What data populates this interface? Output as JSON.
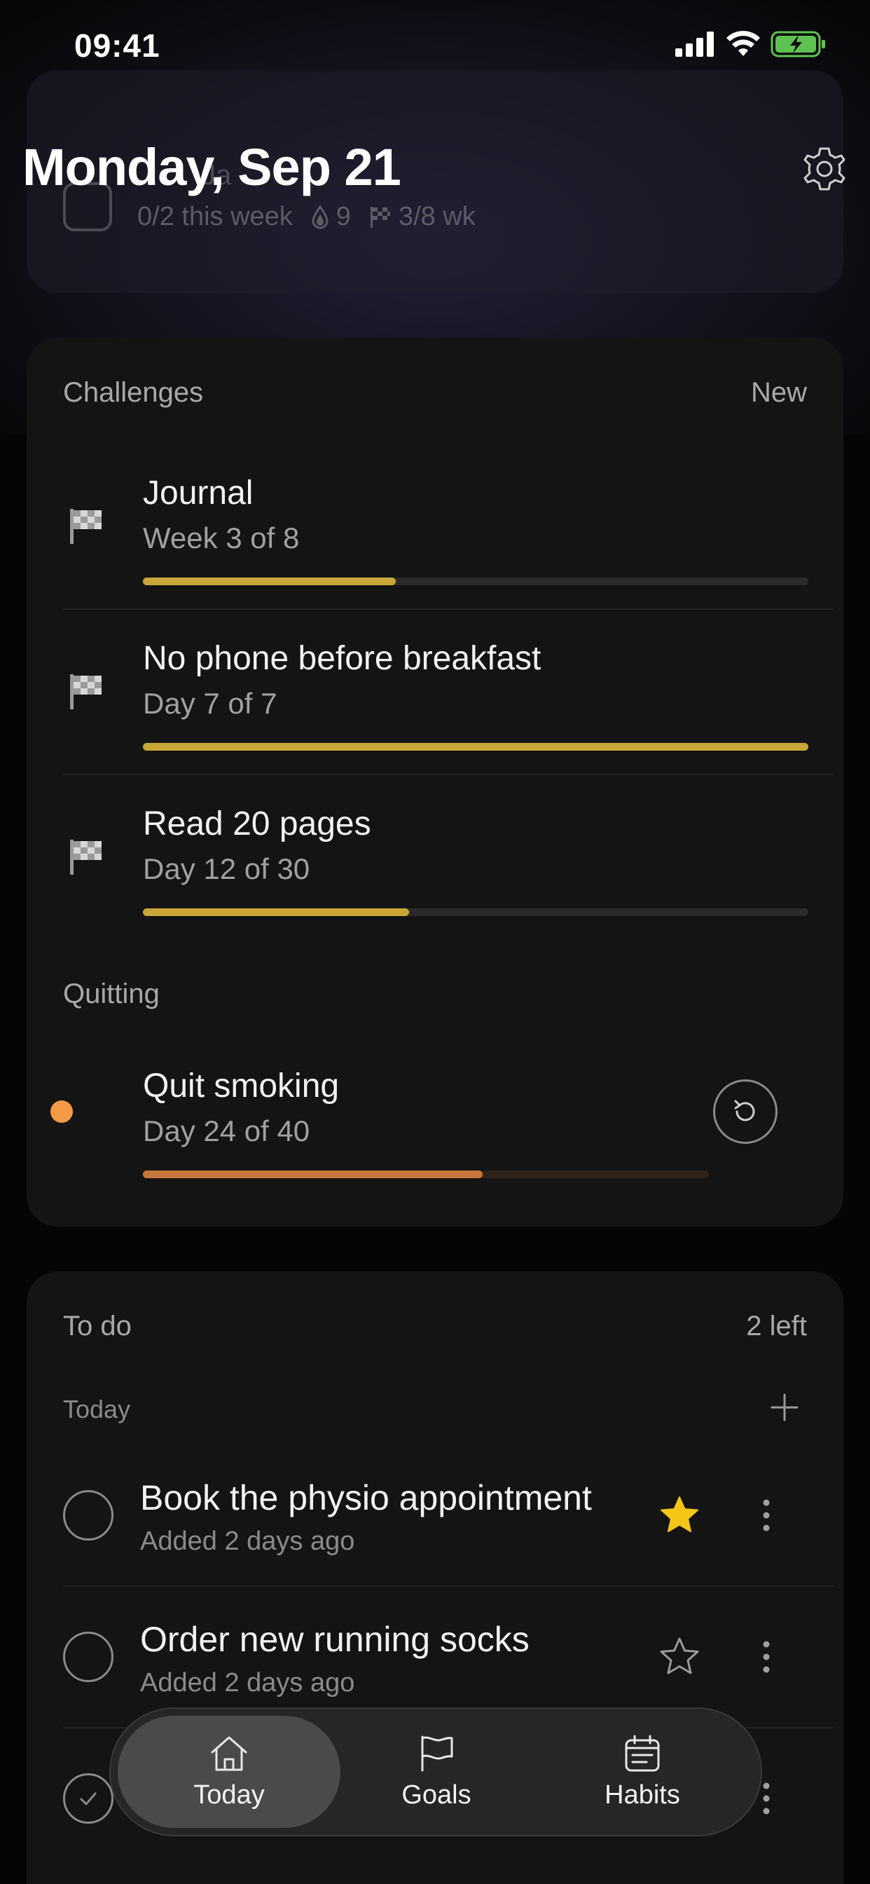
{
  "status": {
    "time": "09:41"
  },
  "header": {
    "title": "Monday, Sep 21"
  },
  "ghost_card": {
    "title": "Ja",
    "meta_progress": "0/2 this week",
    "meta_streak": "9",
    "meta_challenge": "3/8 wk"
  },
  "challenges": {
    "label": "Challenges",
    "action": "New",
    "items": [
      {
        "title": "Journal",
        "subtitle": "Week 3 of 8",
        "progress": 0.38
      },
      {
        "title": "No phone before breakfast",
        "subtitle": "Day 7 of 7",
        "progress": 1.0
      },
      {
        "title": "Read 20 pages",
        "subtitle": "Day 12 of 30",
        "progress": 0.4
      }
    ],
    "quitting_label": "Quitting",
    "quitting": {
      "title": "Quit smoking",
      "subtitle": "Day 24 of 40",
      "progress": 0.6
    }
  },
  "todo": {
    "label": "To do",
    "count": "2 left",
    "section": "Today",
    "items": [
      {
        "title": "Book the physio appointment",
        "subtitle": "Added 2 days ago",
        "starred": true
      },
      {
        "title": "Order new running socks",
        "subtitle": "Added 2 days ago",
        "starred": false
      }
    ]
  },
  "tabs": [
    {
      "label": "Today",
      "icon": "home-icon",
      "active": true
    },
    {
      "label": "Goals",
      "icon": "flag-icon",
      "active": false
    },
    {
      "label": "Habits",
      "icon": "calendar-icon",
      "active": false
    }
  ],
  "colors": {
    "accent_gold": "#c8a736",
    "quit_orange": "#f39a46",
    "star_yellow": "#f5c518"
  }
}
